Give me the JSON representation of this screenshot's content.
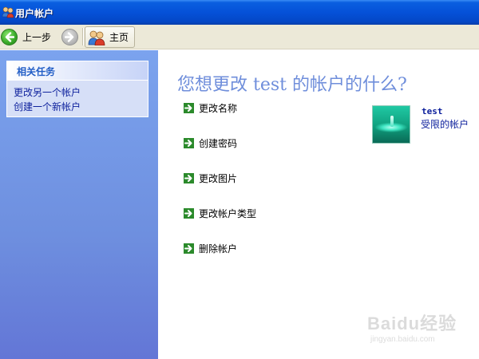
{
  "window": {
    "title": "用户帐户"
  },
  "toolbar": {
    "back_label": "上一步",
    "home_label": "主页",
    "icons": {
      "back": "back-arrow-icon",
      "forward": "forward-arrow-icon",
      "home": "users-home-icon"
    }
  },
  "sidebar": {
    "section_title": "相关任务",
    "links": [
      {
        "label": "更改另一个帐户"
      },
      {
        "label": "创建一个新帐户"
      }
    ]
  },
  "main": {
    "heading": "您想更改 test 的帐户的什么?",
    "options": [
      {
        "label": "更改名称",
        "icon": "green-arrow-icon"
      },
      {
        "label": "创建密码",
        "icon": "green-arrow-icon"
      },
      {
        "label": "更改图片",
        "icon": "green-arrow-icon"
      },
      {
        "label": "更改帐户类型",
        "icon": "green-arrow-icon"
      },
      {
        "label": "删除帐户",
        "icon": "green-arrow-icon"
      }
    ]
  },
  "user": {
    "name": "test",
    "account_type": "受限的帐户",
    "picture": "water-drop-picture"
  },
  "watermark": {
    "main": "Baidu经验",
    "sub": "jingyan.baidu.com"
  },
  "colors": {
    "titlebar": "#0551d8",
    "toolbar": "#ece9d8",
    "taskpane": "#7ba3ee",
    "link": "#0c1f9c",
    "heading": "#6f8edb",
    "option_arrow": "#2b8a2b"
  }
}
